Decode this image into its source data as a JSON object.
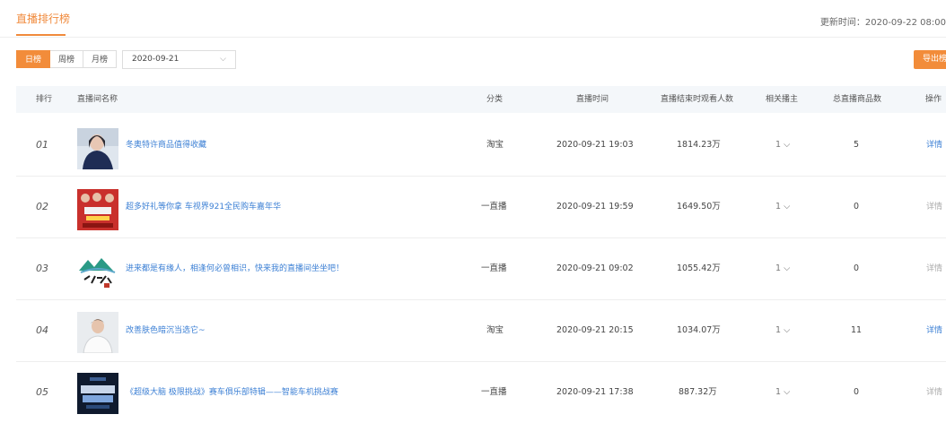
{
  "header": {
    "tab_label": "直播排行榜",
    "updated_text": "更新时间：2020-09-22 08:00"
  },
  "filters": {
    "period_tabs": [
      "日榜",
      "周榜",
      "月榜"
    ],
    "active_period": "日榜",
    "date_value": "2020-09-21",
    "date_icon": "chevron-down-icon",
    "export_label": "导出榜单"
  },
  "table": {
    "headers": [
      "排行",
      "直播间名称",
      "分类",
      "直播时间",
      "直播结束时观看人数",
      "相关播主",
      "总直播商品数",
      "操作"
    ],
    "rows": [
      {
        "rank": "01",
        "title": "冬奥特许商品值得收藏",
        "category": "淘宝",
        "time": "2020-09-21 19:03",
        "viewers": "1814.23万",
        "anchors": "1",
        "products": "5",
        "action": "详情",
        "action_enabled": true,
        "thumb": "woman-in-dark-dress-portrait"
      },
      {
        "rank": "02",
        "title": "超多好礼等你拿 车视界921全民购车嘉年华",
        "category": "一直播",
        "time": "2020-09-21 19:59",
        "viewers": "1649.50万",
        "anchors": "1",
        "products": "0",
        "action": "详情",
        "action_enabled": false,
        "thumb": "red-event-poster"
      },
      {
        "rank": "03",
        "title": "进来都是有缘人，相逢何必曾相识，快来我的直播间坐坐吧！",
        "category": "一直播",
        "time": "2020-09-21 09:02",
        "viewers": "1055.42万",
        "anchors": "1",
        "products": "0",
        "action": "详情",
        "action_enabled": false,
        "thumb": "mountain-calligraphy-logo"
      },
      {
        "rank": "04",
        "title": "改善肤色暗沉当选它~",
        "category": "淘宝",
        "time": "2020-09-21 20:15",
        "viewers": "1034.07万",
        "anchors": "1",
        "products": "11",
        "action": "详情",
        "action_enabled": true,
        "thumb": "man-in-white-shirt-portrait"
      },
      {
        "rank": "05",
        "title": "《超级大脑 极限挑战》赛车俱乐部特辑——智能车机挑战赛",
        "category": "一直播",
        "time": "2020-09-21 17:38",
        "viewers": "887.32万",
        "anchors": "1",
        "products": "0",
        "action": "详情",
        "action_enabled": false,
        "thumb": "dark-racing-poster"
      }
    ]
  }
}
